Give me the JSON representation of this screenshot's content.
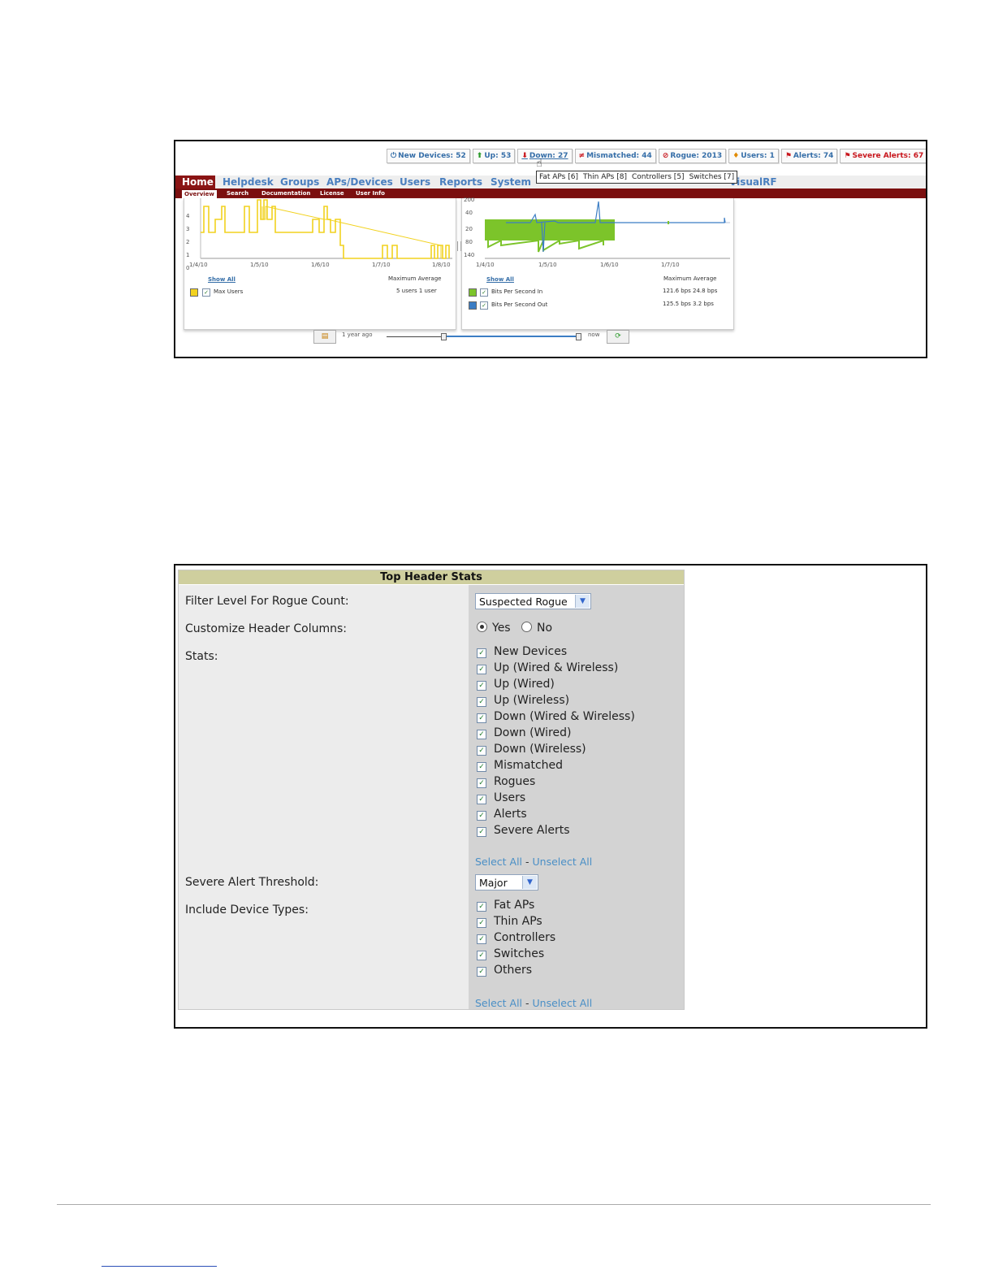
{
  "screenshot1": {
    "stats": [
      {
        "icon": "⏻",
        "label": "New Devices: 52",
        "color": "blue"
      },
      {
        "icon": "⬆",
        "label": "Up: 53",
        "color": "blue"
      },
      {
        "icon": "⬇",
        "label": "Down: 27",
        "color": "blue"
      },
      {
        "icon": "≠",
        "label": "Mismatched: 44",
        "color": "blue"
      },
      {
        "icon": "⊘",
        "label": "Rogue: 2013",
        "color": "blue"
      },
      {
        "icon": "♦",
        "label": "Users: 1",
        "color": "blue"
      },
      {
        "icon": "⚑",
        "label": "Alerts: 74",
        "color": "blue"
      },
      {
        "icon": "⚑",
        "label": "Severe Alerts: 67",
        "color": "red"
      }
    ],
    "tooltip": [
      "Fat APs [6]",
      "Thin APs [8]",
      "Controllers [5]",
      "Switches [7]"
    ],
    "nav": [
      "Home",
      "Helpdesk",
      "Groups",
      "APs/Devices",
      "Users",
      "Reports",
      "System",
      "VisualRF"
    ],
    "subnav": [
      "Overview",
      "Search",
      "Documentation",
      "License",
      "User Info"
    ],
    "users_panel": {
      "y_ticks": [
        "4",
        "3",
        "2",
        "1",
        "0"
      ],
      "x_ticks": [
        "1/4/10",
        "1/5/10",
        "1/6/10",
        "1/7/10",
        "1/8/10"
      ],
      "show_all": "Show All",
      "legend_header": "Maximum  Average",
      "rows": [
        {
          "label": "Max Users",
          "values": "5 users    1 user",
          "color": "#f2d21f"
        }
      ]
    },
    "bandwidth_panel": {
      "y_ticks": [
        "200",
        "40",
        "20",
        "80",
        "140"
      ],
      "x_ticks": [
        "1/4/10",
        "1/5/10",
        "1/6/10",
        "1/7/10"
      ],
      "show_all": "Show All",
      "legend_header": "Maximum  Average",
      "rows": [
        {
          "label": "Bits Per Second In",
          "values": "121.6 bps  24.8 bps",
          "color": "#7cc42a"
        },
        {
          "label": "Bits Per Second Out",
          "values": "125.5 bps    3.2 bps",
          "color": "#3b7dc4"
        }
      ]
    },
    "timebar": {
      "start_label": "1 year ago",
      "end_label": "now"
    }
  },
  "screenshot2": {
    "title": "Top Header Stats",
    "filter_label": "Filter Level For Rogue Count:",
    "filter_value": "Suspected Rogue",
    "customize_label": "Customize Header Columns:",
    "radio_yes": "Yes",
    "radio_no": "No",
    "radio_selected": "Yes",
    "stats_label": "Stats:",
    "stats": [
      "New Devices",
      "Up (Wired & Wireless)",
      "Up (Wired)",
      "Up (Wireless)",
      "Down (Wired & Wireless)",
      "Down (Wired)",
      "Down (Wireless)",
      "Mismatched",
      "Rogues",
      "Users",
      "Alerts",
      "Severe Alerts"
    ],
    "select_all": "Select All",
    "separator": "-",
    "unselect_all": "Unselect All",
    "threshold_label": "Severe Alert Threshold:",
    "threshold_value": "Major",
    "device_types_label": "Include Device Types:",
    "device_types": [
      "Fat APs",
      "Thin APs",
      "Controllers",
      "Switches",
      "Others"
    ]
  }
}
